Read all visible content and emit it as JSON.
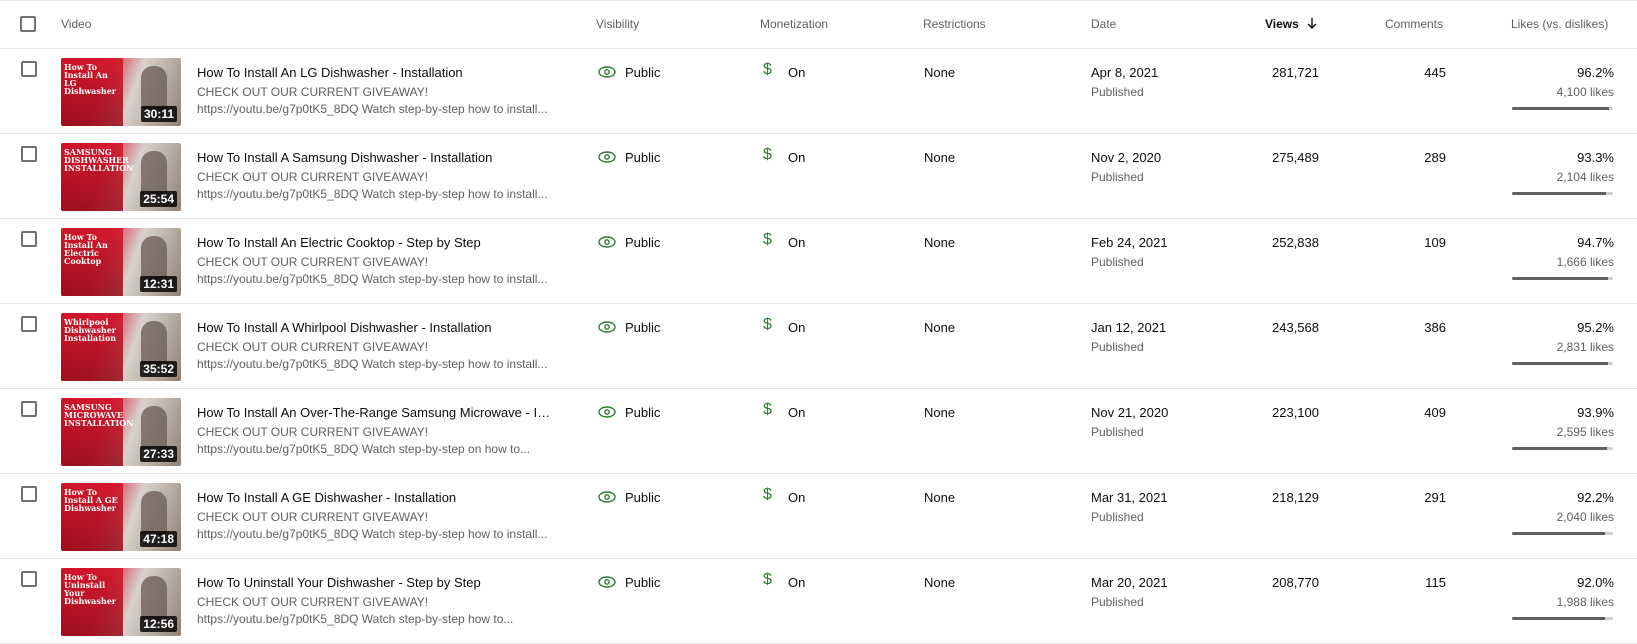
{
  "header": {
    "video": "Video",
    "visibility": "Visibility",
    "monetization": "Monetization",
    "restrictions": "Restrictions",
    "date": "Date",
    "views": "Views",
    "views_sort_icon": "arrow-down-icon",
    "comments": "Comments",
    "likes": "Likes (vs. dislikes)"
  },
  "rows": [
    {
      "thumb_text": "How To Install An LG Dishwasher",
      "duration": "30:11",
      "title": "How To Install An LG Dishwasher - Installation",
      "desc1": "CHECK OUT OUR CURRENT GIVEAWAY!",
      "desc2": "https://youtu.be/g7p0tK5_8DQ Watch step-by-step how to install...",
      "visibility": "Public",
      "monetization": "On",
      "restrictions": "None",
      "date": "Apr 8, 2021",
      "status": "Published",
      "views": "281,721",
      "comments": "445",
      "like_pct": "96.2%",
      "likes": "4,100 likes",
      "like_ratio": 0.962
    },
    {
      "thumb_text": "SAMSUNG DISHWASHER INSTALLATION",
      "duration": "25:54",
      "title": "How To Install A Samsung Dishwasher - Installation",
      "desc1": "CHECK OUT OUR CURRENT GIVEAWAY!",
      "desc2": "https://youtu.be/g7p0tK5_8DQ Watch step-by-step how to install...",
      "visibility": "Public",
      "monetization": "On",
      "restrictions": "None",
      "date": "Nov 2, 2020",
      "status": "Published",
      "views": "275,489",
      "comments": "289",
      "like_pct": "93.3%",
      "likes": "2,104 likes",
      "like_ratio": 0.933
    },
    {
      "thumb_text": "How To Install An Electric Cooktop",
      "duration": "12:31",
      "title": "How To Install An Electric Cooktop - Step by Step",
      "desc1": "CHECK OUT OUR CURRENT GIVEAWAY!",
      "desc2": "https://youtu.be/g7p0tK5_8DQ Watch step-by-step how to install...",
      "visibility": "Public",
      "monetization": "On",
      "restrictions": "None",
      "date": "Feb 24, 2021",
      "status": "Published",
      "views": "252,838",
      "comments": "109",
      "like_pct": "94.7%",
      "likes": "1,666 likes",
      "like_ratio": 0.947
    },
    {
      "thumb_text": "Whirlpool Dishwasher Installation",
      "duration": "35:52",
      "title": "How To Install A Whirlpool Dishwasher - Installation",
      "desc1": "CHECK OUT OUR CURRENT GIVEAWAY!",
      "desc2": "https://youtu.be/g7p0tK5_8DQ Watch step-by-step how to install...",
      "visibility": "Public",
      "monetization": "On",
      "restrictions": "None",
      "date": "Jan 12, 2021",
      "status": "Published",
      "views": "243,568",
      "comments": "386",
      "like_pct": "95.2%",
      "likes": "2,831 likes",
      "like_ratio": 0.952
    },
    {
      "thumb_text": "SAMSUNG MICROWAVE INSTALLATION",
      "duration": "27:33",
      "title": "How To Install An Over-The-Range Samsung Microwave - Ins...",
      "desc1": "CHECK OUT OUR CURRENT GIVEAWAY!",
      "desc2": "https://youtu.be/g7p0tK5_8DQ Watch step-by-step on how to...",
      "visibility": "Public",
      "monetization": "On",
      "restrictions": "None",
      "date": "Nov 21, 2020",
      "status": "Published",
      "views": "223,100",
      "comments": "409",
      "like_pct": "93.9%",
      "likes": "2,595 likes",
      "like_ratio": 0.939
    },
    {
      "thumb_text": "How To Install A GE Dishwasher",
      "duration": "47:18",
      "title": "How To Install A GE Dishwasher - Installation",
      "desc1": "CHECK OUT OUR CURRENT GIVEAWAY!",
      "desc2": "https://youtu.be/g7p0tK5_8DQ Watch step-by-step how to install...",
      "visibility": "Public",
      "monetization": "On",
      "restrictions": "None",
      "date": "Mar 31, 2021",
      "status": "Published",
      "views": "218,129",
      "comments": "291",
      "like_pct": "92.2%",
      "likes": "2,040 likes",
      "like_ratio": 0.922
    },
    {
      "thumb_text": "How To Uninstall Your Dishwasher",
      "duration": "12:56",
      "title": "How To Uninstall Your Dishwasher - Step by Step",
      "desc1": "CHECK OUT OUR CURRENT GIVEAWAY!",
      "desc2": "https://youtu.be/g7p0tK5_8DQ Watch step-by-step how to...",
      "visibility": "Public",
      "monetization": "On",
      "restrictions": "None",
      "date": "Mar 20, 2021",
      "status": "Published",
      "views": "208,770",
      "comments": "115",
      "like_pct": "92.0%",
      "likes": "1,988 likes",
      "like_ratio": 0.92
    }
  ],
  "colors": {
    "monetization_icon": "#2e7d32",
    "visibility_icon": "#2e7d32",
    "thumb_red": "#c3152a"
  }
}
